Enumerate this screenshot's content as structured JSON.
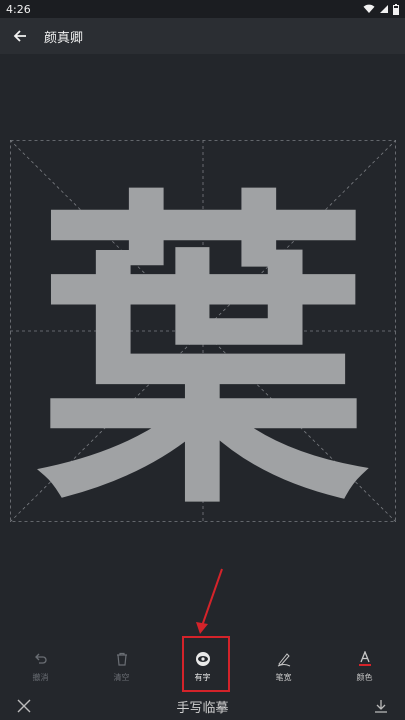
{
  "status": {
    "time": "4:26"
  },
  "appbar": {
    "title": "颜真卿"
  },
  "character": {
    "glyph": "葉",
    "color": "#a0a2a4"
  },
  "toolbar": {
    "items": [
      {
        "label": "撤消",
        "icon": "undo-icon",
        "active": false
      },
      {
        "label": "清空",
        "icon": "trash-icon",
        "active": false
      },
      {
        "label": "有字",
        "icon": "eye-icon",
        "active": true
      },
      {
        "label": "笔宽",
        "icon": "brush-icon",
        "active": false
      },
      {
        "label": "颜色",
        "icon": "color-a-icon",
        "active": false
      }
    ]
  },
  "bottom": {
    "title": "手写临摹"
  },
  "colors": {
    "highlight": "#d4232a",
    "background": "#24272c",
    "appbar": "#2b2e33"
  }
}
